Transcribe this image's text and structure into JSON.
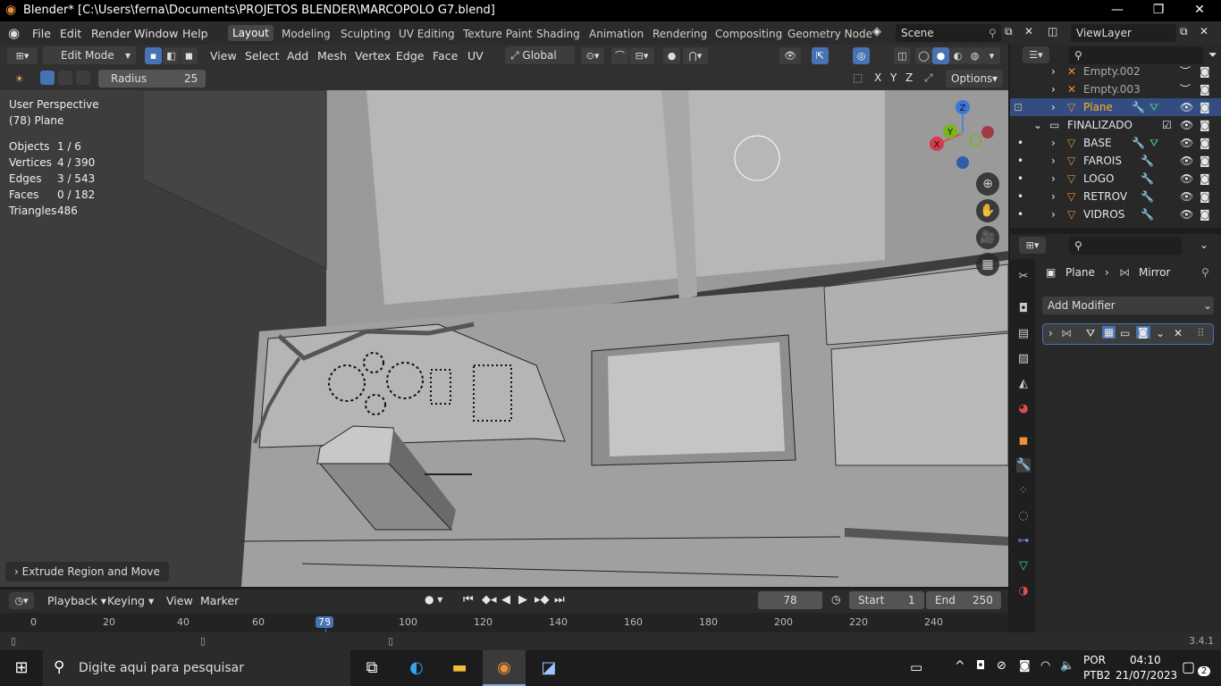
{
  "title_bar": {
    "title": "Blender* [C:\\Users\\ferna\\Documents\\PROJETOS BLENDER\\MARCOPOLO G7.blend]",
    "minimize": "—",
    "restore": "❐",
    "close": "✕"
  },
  "menus": [
    "File",
    "Edit",
    "Render",
    "Window",
    "Help"
  ],
  "workspaces": [
    "Layout",
    "Modeling",
    "Sculpting",
    "UV Editing",
    "Texture Paint",
    "Shading",
    "Animation",
    "Rendering",
    "Compositing",
    "Geometry Node"
  ],
  "scene": "Scene",
  "view_layer": "ViewLayer",
  "header": {
    "mode": "Edit Mode",
    "menus": [
      "View",
      "Select",
      "Add",
      "Mesh",
      "Vertex",
      "Edge",
      "Face",
      "UV"
    ],
    "orientation": "Global"
  },
  "tool_settings": {
    "radius_label": "Radius",
    "radius_value": "25",
    "options": "Options",
    "axes": [
      "X",
      "Y",
      "Z"
    ]
  },
  "viewport": {
    "perspective": "User Perspective",
    "object": "(78) Plane",
    "stats": [
      {
        "label": "Objects",
        "value": "1 / 6"
      },
      {
        "label": "Vertices",
        "value": "4 / 390"
      },
      {
        "label": "Edges",
        "value": "3 / 543"
      },
      {
        "label": "Faces",
        "value": "0 / 182"
      },
      {
        "label": "Triangles",
        "value": "486"
      }
    ],
    "gizmo": {
      "x": "X",
      "y": "Y",
      "z": "Z"
    }
  },
  "operator_panel": "Extrude Region and Move",
  "timeline": {
    "menus": [
      "Playback",
      "Keying",
      "View",
      "Marker"
    ],
    "current_frame": "78",
    "start_label": "Start",
    "start": "1",
    "end_label": "End",
    "end": "250",
    "ticks": [
      "0",
      "20",
      "40",
      "60",
      "78",
      "100",
      "120",
      "140",
      "160",
      "180",
      "200",
      "220",
      "240"
    ]
  },
  "outliner": {
    "items": [
      {
        "name": "Empty.002"
      },
      {
        "name": "Empty.003"
      },
      {
        "name": "Plane"
      },
      {
        "name": "FINALIZADO"
      },
      {
        "name": "BASE"
      },
      {
        "name": "FAROIS"
      },
      {
        "name": "LOGO"
      },
      {
        "name": "RETROV"
      },
      {
        "name": "VIDROS"
      }
    ]
  },
  "properties": {
    "breadcrumb_object": "Plane",
    "breadcrumb_modifier": "Mirror",
    "add_modifier": "Add Modifier"
  },
  "status": {
    "version": "3.4.1"
  },
  "taskbar": {
    "search_placeholder": "Digite aqui para pesquisar",
    "lang1": "POR",
    "lang2": "PTB2",
    "time": "04:10",
    "date": "21/07/2023",
    "notifications": "2"
  },
  "colors": {
    "accent": "#4772b3",
    "selected_row": "#334d80",
    "orange": "#e8913a"
  }
}
